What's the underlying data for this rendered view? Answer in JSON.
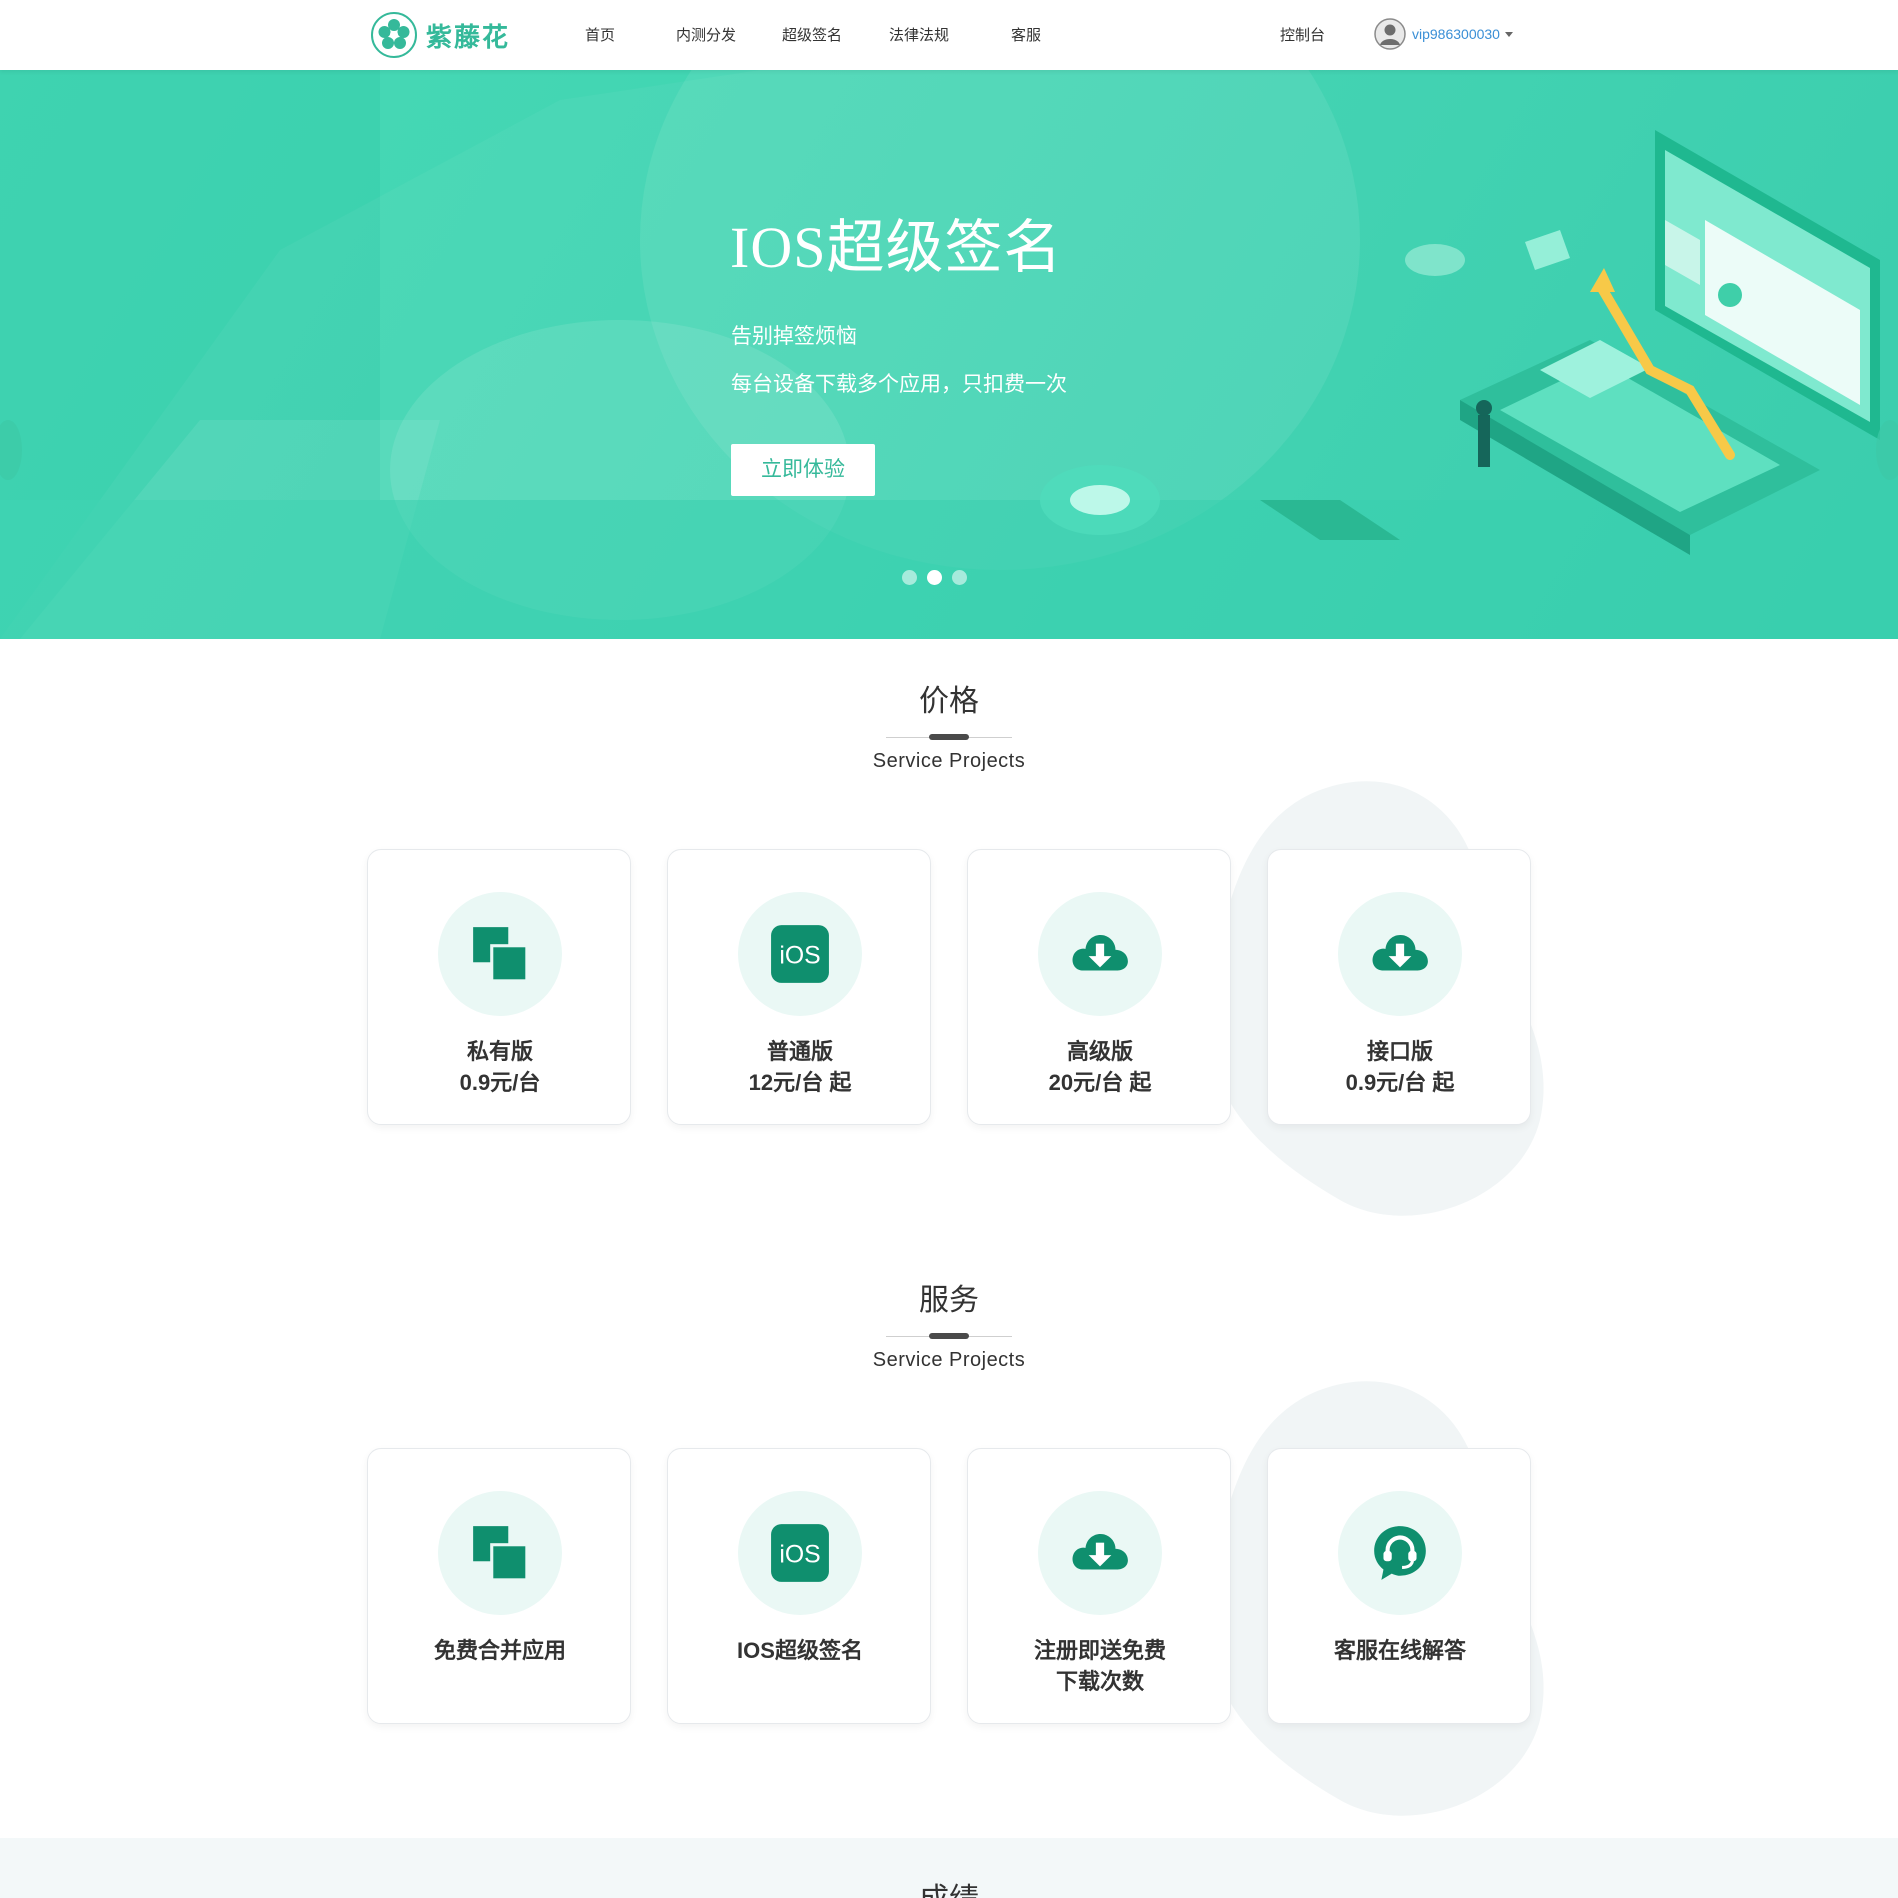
{
  "brand": {
    "name": "紫藤花",
    "color": "#35b99a"
  },
  "nav": {
    "items": [
      "首页",
      "内测分发",
      "超级签名",
      "法律法规",
      "客服"
    ]
  },
  "header_right": {
    "console": "控制台",
    "username": "vip986300030"
  },
  "banner": {
    "title": "IOS超级签名",
    "line1": "告别掉签烦恼",
    "line2": "每台设备下载多个应用，只扣费一次",
    "button": "立即体验",
    "slides": 3,
    "active_slide": 2
  },
  "pricing": {
    "title": "价格",
    "subtitle": "Service Projects",
    "cards": [
      {
        "icon": "copy-icon",
        "name": "私有版",
        "price": "0.9元/台"
      },
      {
        "icon": "ios-icon",
        "name": "普通版",
        "price": "12元/台 起"
      },
      {
        "icon": "cloud-download-icon",
        "name": "高级版",
        "price": "20元/台 起"
      },
      {
        "icon": "cloud-download-icon",
        "name": "接口版",
        "price": "0.9元/台 起"
      }
    ]
  },
  "services": {
    "title": "服务",
    "subtitle": "Service Projects",
    "cards": [
      {
        "icon": "copy-icon",
        "line1": "免费合并应用",
        "line2": ""
      },
      {
        "icon": "ios-icon",
        "line1": "IOS超级签名",
        "line2": ""
      },
      {
        "icon": "cloud-download-icon",
        "line1": "注册即送免费",
        "line2": "下载次数"
      },
      {
        "icon": "support-chat-icon",
        "line1": "客服在线解答",
        "line2": ""
      }
    ]
  },
  "next_section": {
    "title": "成绩"
  },
  "colors": {
    "accent": "#35b99a",
    "icon_dark": "#0f8f6e",
    "icon_bg": "#eaf8f5",
    "banner": "#3fd4b1"
  }
}
